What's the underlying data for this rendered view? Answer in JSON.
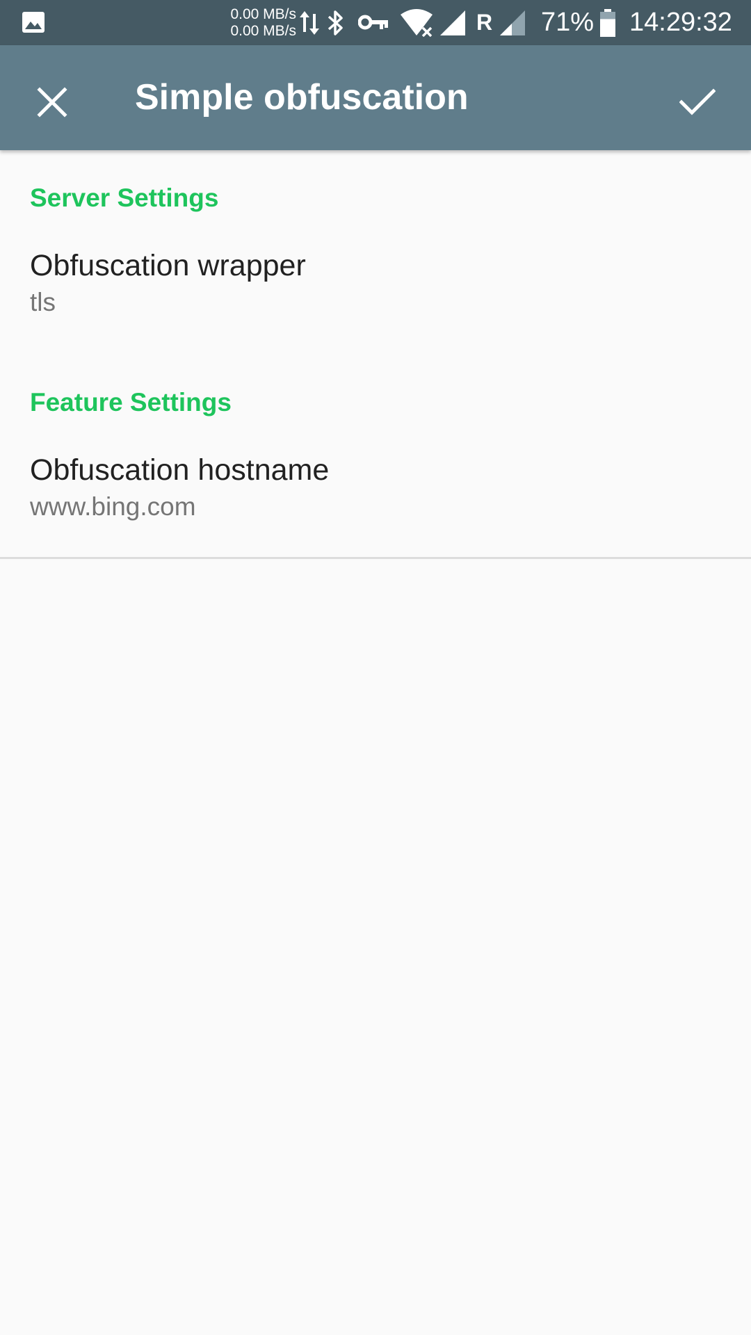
{
  "status_bar": {
    "upload_speed": "0.00 MB/s",
    "download_speed": "0.00 MB/s",
    "roaming_label": "R",
    "battery_percent": "71%",
    "battery_level": 0.71,
    "time": "14:29:32",
    "icons": [
      "gallery-icon",
      "data-arrows-icon",
      "bluetooth-icon",
      "vpn-key-icon",
      "wifi-x-icon",
      "signal-icon",
      "signal-icon",
      "battery-icon"
    ],
    "background_color": "#455a64"
  },
  "app_bar": {
    "title": "Simple obfuscation",
    "close_icon": "close-icon",
    "confirm_icon": "check-icon",
    "background_color": "#607d8b"
  },
  "sections": [
    {
      "header": "Server Settings",
      "items": [
        {
          "title": "Obfuscation wrapper",
          "summary": "tls"
        }
      ]
    },
    {
      "header": "Feature Settings",
      "items": [
        {
          "title": "Obfuscation hostname",
          "summary": "www.bing.com"
        }
      ]
    }
  ],
  "colors": {
    "accent": "#1ec45c",
    "primary_text": "#212121",
    "secondary_text": "#757575",
    "background": "#fafafa"
  }
}
